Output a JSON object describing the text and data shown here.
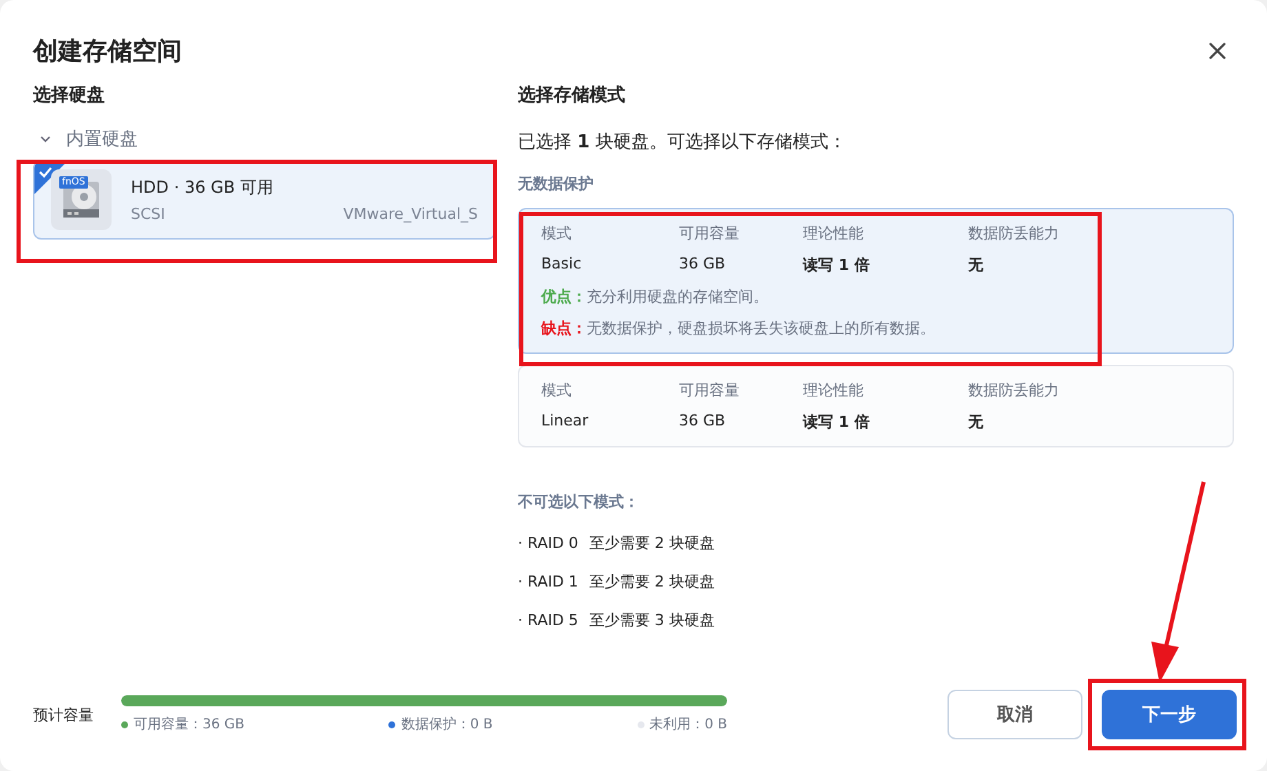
{
  "dialog": {
    "title": "创建存储空间"
  },
  "disk_section": {
    "heading": "选择硬盘",
    "group": {
      "label": "内置硬盘",
      "expanded": true,
      "disks": [
        {
          "badge": "fnOS",
          "title": "HDD · 36 GB 可用",
          "interface": "SCSI",
          "model": "VMware_Virtual_S",
          "selected": true
        }
      ]
    }
  },
  "mode_section": {
    "heading": "选择存储模式",
    "summary": "已选择 **1** 块硬盘。可选择以下存储模式：",
    "group_label": "无数据保护",
    "modes": [
      {
        "selected": true,
        "fields": [
          {
            "label": "模式",
            "value": "Basic",
            "emphasis": false
          },
          {
            "label": "可用容量",
            "value": "36 GB",
            "emphasis": false
          },
          {
            "label": "理论性能",
            "value": "读写 1 倍",
            "emphasis": true
          },
          {
            "label": "数据防丢能力",
            "value": "无",
            "emphasis": true
          }
        ],
        "pros_label": "优点：",
        "pros": "充分利用硬盘的存储空间。",
        "cons_label": "缺点：",
        "cons": "无数据保护，硬盘损坏将丢失该硬盘上的所有数据。"
      },
      {
        "selected": false,
        "fields": [
          {
            "label": "模式",
            "value": "Linear",
            "emphasis": false
          },
          {
            "label": "可用容量",
            "value": "36 GB",
            "emphasis": false
          },
          {
            "label": "理论性能",
            "value": "读写 1 倍",
            "emphasis": true
          },
          {
            "label": "数据防丢能力",
            "value": "无",
            "emphasis": true
          }
        ]
      }
    ],
    "unavailable_heading": "不可选以下模式：",
    "unavailable": [
      {
        "mode": "· RAID 0",
        "requirement": "至少需要 2 块硬盘"
      },
      {
        "mode": "· RAID 1",
        "requirement": "至少需要 2 块硬盘"
      },
      {
        "mode": "· RAID 5",
        "requirement": "至少需要 3 块硬盘"
      }
    ]
  },
  "footer": {
    "capacity_label": "预计容量",
    "level": 1,
    "legend": [
      {
        "text": "可用容量：36 GB",
        "color": "#5aa85a"
      },
      {
        "text": "数据保护：0 B",
        "color": "#2f72d8"
      },
      {
        "text": "未利用：0 B",
        "color": "#e6e8ee"
      }
    ],
    "buttons": [
      {
        "label": "取消",
        "kind": "secondary"
      },
      {
        "label": "下一步",
        "kind": "primary"
      }
    ]
  }
}
